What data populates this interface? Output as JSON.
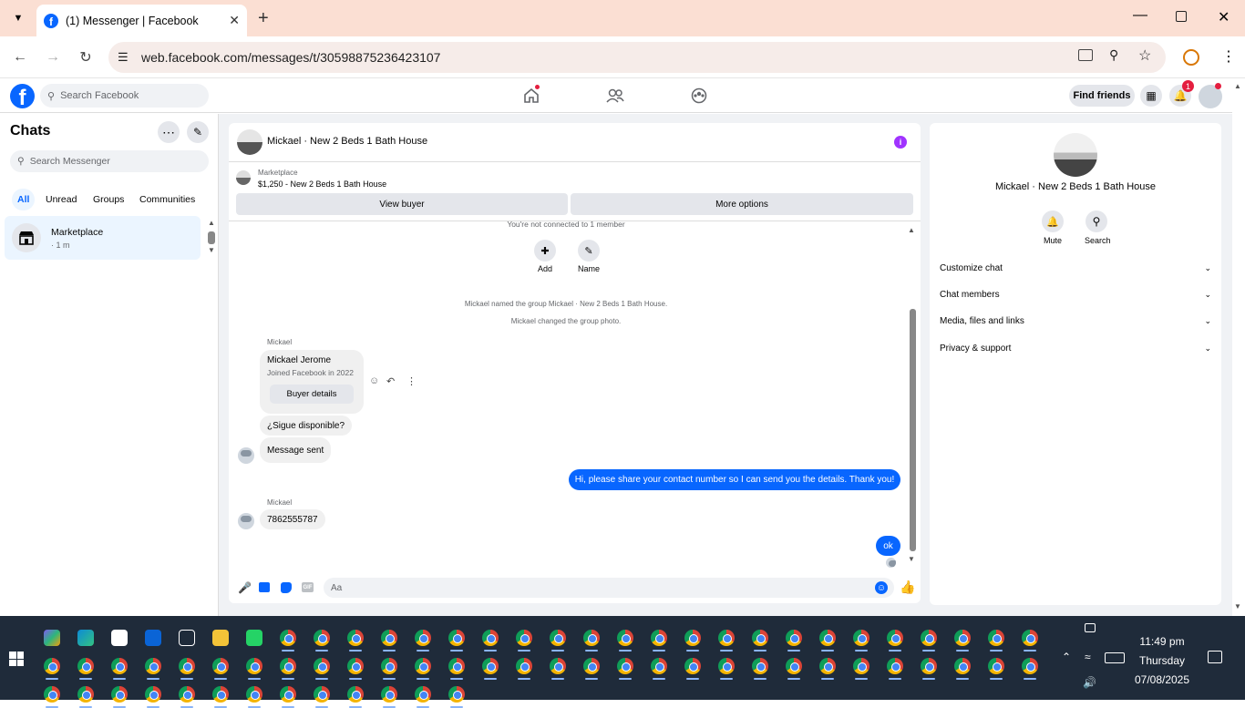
{
  "browser": {
    "tab_title": "(1) Messenger | Facebook",
    "url": "web.facebook.com/messages/t/30598875236423107"
  },
  "fb_header": {
    "search_placeholder": "Search Facebook",
    "find_friends": "Find friends",
    "notification_count": "1"
  },
  "left": {
    "title": "Chats",
    "search_placeholder": "Search Messenger",
    "filters": [
      "All",
      "Unread",
      "Groups",
      "Communities"
    ],
    "chat_item": {
      "name": "Marketplace",
      "time": "· 1 m"
    }
  },
  "chat": {
    "title": "Mickael · New 2 Beds 1 Bath House",
    "listing_label": "Marketplace",
    "listing_price": "$1,250 - New 2 Beds 1 Bath House",
    "view_buyer": "View buyer",
    "more_options": "More options",
    "not_connected": "You're not connected to 1 member",
    "add_label": "Add",
    "name_label": "Name",
    "event1": "Mickael named the group Mickael · New 2 Beds 1 Bath House.",
    "event2": "Mickael changed the group photo.",
    "sender1": "Mickael",
    "buyer_name": "Mickael Jerome",
    "buyer_joined": "Joined Facebook in 2022",
    "buyer_details": "Buyer details",
    "msg1": "¿Sigue disponible?",
    "msg2": "Message sent",
    "out1": "Hi, please share your contact number so I can send you the details. Thank you!",
    "sender2": "Mickael",
    "msg3": "7862555787",
    "out2": "ok",
    "composer_placeholder": "Aa"
  },
  "right": {
    "name": "Mickael · New 2 Beds 1 Bath House",
    "mute": "Mute",
    "search": "Search",
    "sections": [
      "Customize chat",
      "Chat members",
      "Media, files and links",
      "Privacy & support"
    ]
  },
  "taskbar": {
    "time": "11:49 pm",
    "day": "Thursday",
    "date": "07/08/2025"
  },
  "colors": {
    "accent": "#0866ff",
    "tabstrip": "#fbdfd3",
    "taskbar": "#1f2b3a"
  }
}
